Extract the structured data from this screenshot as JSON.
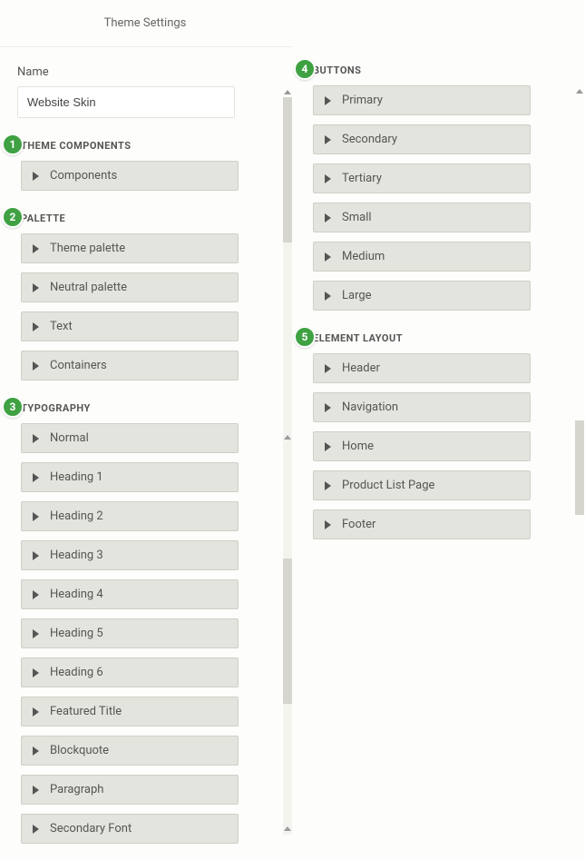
{
  "title": "Theme Settings",
  "name_label": "Name",
  "name_value": "Website Skin",
  "badges": {
    "theme_components": "1",
    "palette": "2",
    "typography": "3",
    "buttons": "4",
    "element_layout": "5"
  },
  "sections": {
    "theme_components": {
      "heading": "THEME COMPONENTS",
      "items": [
        "Components"
      ]
    },
    "palette": {
      "heading": "PALETTE",
      "items": [
        "Theme palette",
        "Neutral palette",
        "Text",
        "Containers"
      ]
    },
    "typography": {
      "heading": "TYPOGRAPHY",
      "items": [
        "Normal",
        "Heading 1",
        "Heading 2",
        "Heading 3",
        "Heading 4",
        "Heading 5",
        "Heading 6",
        "Featured Title",
        "Blockquote",
        "Paragraph",
        "Secondary Font"
      ]
    },
    "buttons": {
      "heading": "BUTTONS",
      "items": [
        "Primary",
        "Secondary",
        "Tertiary",
        "Small",
        "Medium",
        "Large"
      ]
    },
    "element_layout": {
      "heading": "ELEMENT LAYOUT",
      "items": [
        "Header",
        "Navigation",
        "Home",
        "Product List Page",
        "Footer"
      ]
    }
  }
}
